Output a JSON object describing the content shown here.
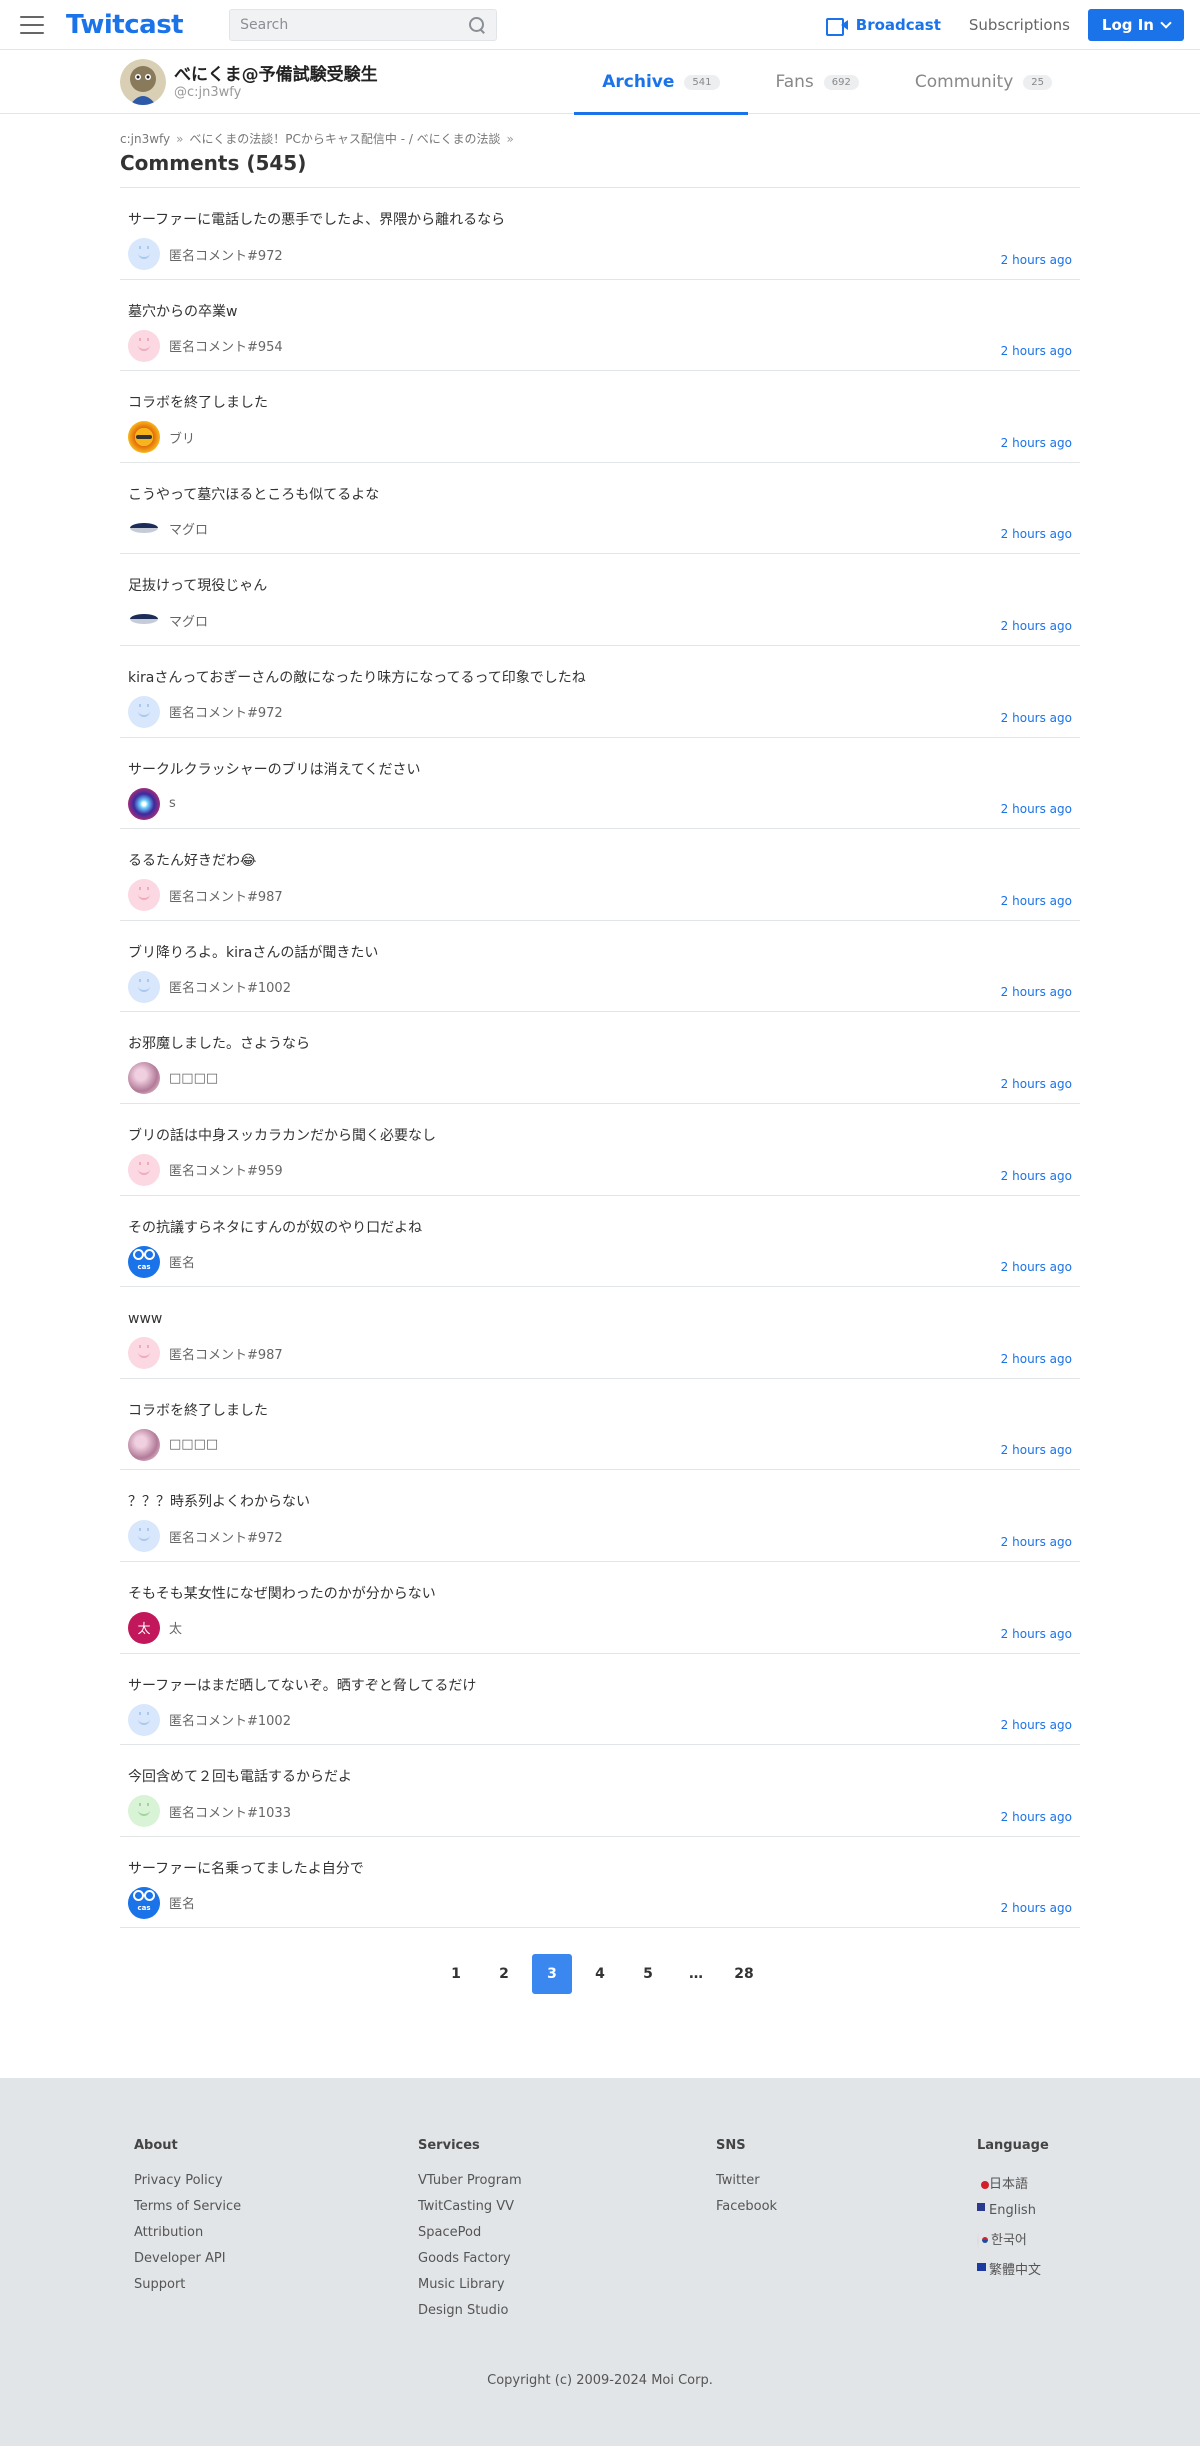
{
  "header": {
    "logo": "Twitcast",
    "search_placeholder": "Search",
    "broadcast": "Broadcast",
    "subscriptions": "Subscriptions",
    "login": "Log In"
  },
  "user": {
    "name": "べにくま@予備試験受験生",
    "id": "@c:jn3wfy"
  },
  "tabs": [
    {
      "label": "Archive",
      "count": "541"
    },
    {
      "label": "Fans",
      "count": "692"
    },
    {
      "label": "Community",
      "count": "25"
    }
  ],
  "breadcrumb": [
    "c:jn3wfy",
    "べにくまの法談！PCからキャス配信中 - / べにくまの法談"
  ],
  "page_title": "Comments (545)",
  "comments": [
    {
      "text": "サーファーに電話したの悪手でしたよ、界隈から離れるなら",
      "name": "匿名コメント#972",
      "avatar": "anon-blue",
      "time": "2 hours ago"
    },
    {
      "text": "墓穴からの卒業w",
      "name": "匿名コメント#954",
      "avatar": "anon-pink",
      "time": "2 hours ago"
    },
    {
      "text": "コラボを終了しました",
      "name": "ブリ",
      "avatar": "sun",
      "time": "2 hours ago"
    },
    {
      "text": "こうやって墓穴ほるところも似てるよな",
      "name": "マグロ",
      "avatar": "tuna",
      "time": "2 hours ago"
    },
    {
      "text": "足抜けって現役じゃん",
      "name": "マグロ",
      "avatar": "tuna",
      "time": "2 hours ago"
    },
    {
      "text": "kiraさんっておぎーさんの敵になったり味方になってるって印象でしたね",
      "name": "匿名コメント#972",
      "avatar": "anon-blue",
      "time": "2 hours ago"
    },
    {
      "text": "サークルクラッシャーのブリは消えてください",
      "name": "s",
      "avatar": "galaxy",
      "time": "2 hours ago"
    },
    {
      "text": "るるたん好きだわ😂",
      "name": "匿名コメント#987",
      "avatar": "anon-pink",
      "time": "2 hours ago"
    },
    {
      "text": "ブリ降りろよ。kiraさんの話が聞きたい",
      "name": "匿名コメント#1002",
      "avatar": "anon-blue",
      "time": "2 hours ago"
    },
    {
      "text": "お邪魔しました。さようなら",
      "name": "□□□□",
      "avatar": "photo",
      "time": "2 hours ago"
    },
    {
      "text": "ブリの話は中身スッカラカンだから聞く必要なし",
      "name": "匿名コメント#959",
      "avatar": "anon-pink",
      "time": "2 hours ago"
    },
    {
      "text": "その抗議すらネタにすんのが奴のやり口だよね",
      "name": "匿名",
      "avatar": "cas",
      "time": "2 hours ago"
    },
    {
      "text": "www",
      "name": "匿名コメント#987",
      "avatar": "anon-pink",
      "time": "2 hours ago"
    },
    {
      "text": "コラボを終了しました",
      "name": "□□□□",
      "avatar": "photo",
      "time": "2 hours ago"
    },
    {
      "text": "？？？時系列よくわからない",
      "name": "匿名コメント#972",
      "avatar": "anon-blue",
      "time": "2 hours ago"
    },
    {
      "text": "そもそも某女性になぜ関わったのかが分からない",
      "name": "太",
      "avatar": "letter",
      "time": "2 hours ago"
    },
    {
      "text": "サーファーはまだ晒してないぞ。晒すぞと脅してるだけ",
      "name": "匿名コメント#1002",
      "avatar": "anon-blue",
      "time": "2 hours ago"
    },
    {
      "text": "今回含めて２回も電話するからだよ",
      "name": "匿名コメント#1033",
      "avatar": "anon-green",
      "time": "2 hours ago"
    },
    {
      "text": "サーファーに名乗ってましたよ自分で",
      "name": "匿名",
      "avatar": "cas",
      "time": "2 hours ago"
    }
  ],
  "pagination": [
    "1",
    "2",
    "3",
    "4",
    "5",
    "…",
    "28"
  ],
  "pagination_active": "3",
  "footer": {
    "about_title": "About",
    "about": [
      "Privacy Policy",
      "Terms of Service",
      "Attribution",
      "Developer API",
      "Support"
    ],
    "services_title": "Services",
    "services": [
      "VTuber Program",
      "TwitCasting VV",
      "SpacePod",
      "Goods Factory",
      "Music Library",
      "Design Studio"
    ],
    "sns_title": "SNS",
    "sns": [
      "Twitter",
      "Facebook"
    ],
    "language_title": "Language",
    "languages": [
      {
        "label": "日本語",
        "flag": "jp"
      },
      {
        "label": "English",
        "flag": "us"
      },
      {
        "label": "한국어",
        "flag": "kr"
      },
      {
        "label": "繁體中文",
        "flag": "tw"
      }
    ],
    "copyright": "Copyright (c) 2009-2024 Moi Corp."
  }
}
